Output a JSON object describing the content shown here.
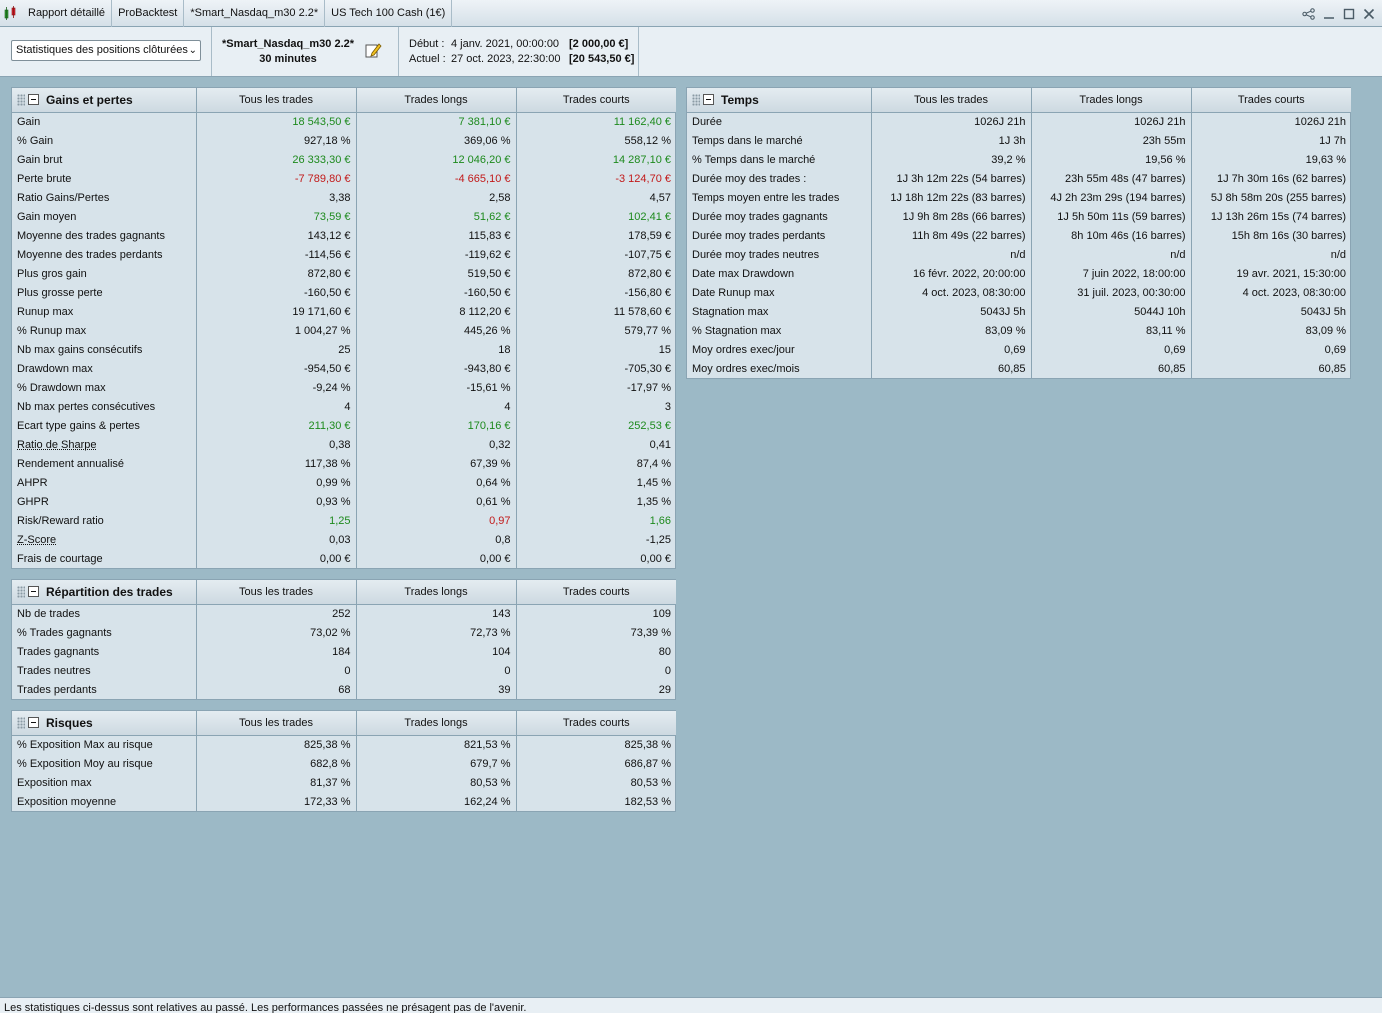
{
  "titlebar": {
    "crumbs": [
      "Rapport détaillé",
      "ProBacktest",
      "*Smart_Nasdaq_m30 2.2*",
      "US Tech 100 Cash (1€)"
    ]
  },
  "header": {
    "select_value": "Statistiques des positions clôturées",
    "strategy_name": "*Smart_Nasdaq_m30 2.2*",
    "timeframe": "30 minutes",
    "start_label": "Début :",
    "start_date": "4 janv. 2021, 00:00:00",
    "start_amount": "[2 000,00 €]",
    "current_label": "Actuel :",
    "current_date": "27 oct. 2023, 22:30:00",
    "current_amount": "[20 543,50 €]"
  },
  "columns": [
    "Tous les trades",
    "Trades longs",
    "Trades courts"
  ],
  "panels": {
    "gains": {
      "title": "Gains et pertes",
      "rows": [
        {
          "label": "Gain",
          "values": [
            "18 543,50 €",
            "7 381,10 €",
            "11 162,40 €"
          ],
          "colors": [
            "green",
            "green",
            "green"
          ]
        },
        {
          "label": "% Gain",
          "values": [
            "927,18 %",
            "369,06 %",
            "558,12 %"
          ]
        },
        {
          "label": "Gain brut",
          "values": [
            "26 333,30 €",
            "12 046,20 €",
            "14 287,10 €"
          ],
          "colors": [
            "green",
            "green",
            "green"
          ]
        },
        {
          "label": "Perte brute",
          "values": [
            "-7 789,80 €",
            "-4 665,10 €",
            "-3 124,70 €"
          ],
          "colors": [
            "red",
            "red",
            "red"
          ]
        },
        {
          "label": "Ratio Gains/Pertes",
          "values": [
            "3,38",
            "2,58",
            "4,57"
          ]
        },
        {
          "label": "Gain moyen",
          "values": [
            "73,59 €",
            "51,62 €",
            "102,41 €"
          ],
          "colors": [
            "green",
            "green",
            "green"
          ]
        },
        {
          "label": "Moyenne des trades gagnants",
          "values": [
            "143,12 €",
            "115,83 €",
            "178,59 €"
          ]
        },
        {
          "label": "Moyenne des trades perdants",
          "values": [
            "-114,56 €",
            "-119,62 €",
            "-107,75 €"
          ]
        },
        {
          "label": "Plus gros gain",
          "values": [
            "872,80 €",
            "519,50 €",
            "872,80 €"
          ]
        },
        {
          "label": "Plus grosse perte",
          "values": [
            "-160,50 €",
            "-160,50 €",
            "-156,80 €"
          ]
        },
        {
          "label": "Runup max",
          "values": [
            "19 171,60 €",
            "8 112,20 €",
            "11 578,60 €"
          ]
        },
        {
          "label": "% Runup max",
          "values": [
            "1 004,27 %",
            "445,26 %",
            "579,77 %"
          ]
        },
        {
          "label": "Nb max gains consécutifs",
          "values": [
            "25",
            "18",
            "15"
          ]
        },
        {
          "label": "Drawdown max",
          "values": [
            "-954,50 €",
            "-943,80 €",
            "-705,30 €"
          ]
        },
        {
          "label": "% Drawdown max",
          "values": [
            "-9,24 %",
            "-15,61 %",
            "-17,97 %"
          ]
        },
        {
          "label": "Nb max pertes consécutives",
          "values": [
            "4",
            "4",
            "3"
          ]
        },
        {
          "label": "Ecart type gains & pertes",
          "values": [
            "211,30 €",
            "170,16 €",
            "252,53 €"
          ],
          "colors": [
            "green",
            "green",
            "green"
          ]
        },
        {
          "label": "Ratio de Sharpe",
          "values": [
            "0,38",
            "0,32",
            "0,41"
          ],
          "underline": true
        },
        {
          "label": "Rendement annualisé",
          "values": [
            "117,38 %",
            "67,39 %",
            "87,4 %"
          ]
        },
        {
          "label": "AHPR",
          "values": [
            "0,99 %",
            "0,64 %",
            "1,45 %"
          ]
        },
        {
          "label": "GHPR",
          "values": [
            "0,93 %",
            "0,61 %",
            "1,35 %"
          ]
        },
        {
          "label": "Risk/Reward ratio",
          "values": [
            "1,25",
            "0,97",
            "1,66"
          ],
          "colors": [
            "green",
            "red",
            "green"
          ]
        },
        {
          "label": "Z-Score",
          "values": [
            "0,03",
            "0,8",
            "-1,25"
          ],
          "underline": true
        },
        {
          "label": "Frais de courtage",
          "values": [
            "0,00 €",
            "0,00 €",
            "0,00 €"
          ]
        }
      ]
    },
    "repartition": {
      "title": "Répartition des trades",
      "rows": [
        {
          "label": "Nb de trades",
          "values": [
            "252",
            "143",
            "109"
          ]
        },
        {
          "label": "% Trades gagnants",
          "values": [
            "73,02 %",
            "72,73 %",
            "73,39 %"
          ]
        },
        {
          "label": "Trades gagnants",
          "values": [
            "184",
            "104",
            "80"
          ]
        },
        {
          "label": "Trades neutres",
          "values": [
            "0",
            "0",
            "0"
          ]
        },
        {
          "label": "Trades perdants",
          "values": [
            "68",
            "39",
            "29"
          ]
        }
      ]
    },
    "risques": {
      "title": "Risques",
      "rows": [
        {
          "label": "% Exposition Max au risque",
          "values": [
            "825,38 %",
            "821,53 %",
            "825,38 %"
          ]
        },
        {
          "label": "% Exposition Moy au risque",
          "values": [
            "682,8 %",
            "679,7 %",
            "686,87 %"
          ]
        },
        {
          "label": "Exposition max",
          "values": [
            "81,37 %",
            "80,53 %",
            "80,53 %"
          ]
        },
        {
          "label": "Exposition moyenne",
          "values": [
            "172,33 %",
            "162,24 %",
            "182,53 %"
          ]
        }
      ]
    },
    "temps": {
      "title": "Temps",
      "rows": [
        {
          "label": "Durée",
          "values": [
            "1026J 21h",
            "1026J 21h",
            "1026J 21h"
          ]
        },
        {
          "label": "Temps dans le marché",
          "values": [
            "1J 3h",
            "23h 55m",
            "1J 7h"
          ]
        },
        {
          "label": "% Temps dans le marché",
          "values": [
            "39,2 %",
            "19,56 %",
            "19,63 %"
          ]
        },
        {
          "label": "Durée moy des trades :",
          "values": [
            "1J 3h 12m 22s (54 barres)",
            "23h 55m 48s (47 barres)",
            "1J 7h 30m 16s (62 barres)"
          ]
        },
        {
          "label": "Temps moyen entre les trades",
          "values": [
            "1J 18h 12m 22s (83 barres)",
            "4J 2h 23m 29s (194 barres)",
            "5J 8h 58m 20s (255 barres)"
          ]
        },
        {
          "label": "Durée moy trades gagnants",
          "values": [
            "1J 9h 8m 28s (66 barres)",
            "1J 5h 50m 11s (59 barres)",
            "1J 13h 26m 15s (74 barres)"
          ]
        },
        {
          "label": "Durée moy trades perdants",
          "values": [
            "11h 8m 49s (22 barres)",
            "8h 10m 46s (16 barres)",
            "15h 8m 16s (30 barres)"
          ]
        },
        {
          "label": "Durée moy trades neutres",
          "values": [
            "n/d",
            "n/d",
            "n/d"
          ]
        },
        {
          "label": "Date max Drawdown",
          "values": [
            "16 févr. 2022, 20:00:00",
            "7 juin 2022, 18:00:00",
            "19 avr. 2021, 15:30:00"
          ]
        },
        {
          "label": "Date Runup max",
          "values": [
            "4 oct. 2023, 08:30:00",
            "31 juil. 2023, 00:30:00",
            "4 oct. 2023, 08:30:00"
          ]
        },
        {
          "label": "Stagnation max",
          "values": [
            "5043J 5h",
            "5044J 10h",
            "5043J 5h"
          ]
        },
        {
          "label": "% Stagnation max",
          "values": [
            "83,09 %",
            "83,11 %",
            "83,09 %"
          ]
        },
        {
          "label": "Moy ordres exec/jour",
          "values": [
            "0,69",
            "0,69",
            "0,69"
          ]
        },
        {
          "label": "Moy ordres exec/mois",
          "values": [
            "60,85",
            "60,85",
            "60,85"
          ]
        }
      ]
    }
  },
  "footer": {
    "disclaimer": "Les statistiques ci-dessus sont relatives au passé. Les performances passées ne présagent pas de l'avenir."
  },
  "colors": {
    "green": "#1d8a1d",
    "red": "#c21a1a",
    "background": "#9cb9c6",
    "panel": "#d7e3ea"
  },
  "icons": [
    "chart-app-icon",
    "share-icon",
    "minimize-icon",
    "maximize-icon",
    "close-icon",
    "edit-icon",
    "collapse-icon",
    "grip-icon"
  ]
}
